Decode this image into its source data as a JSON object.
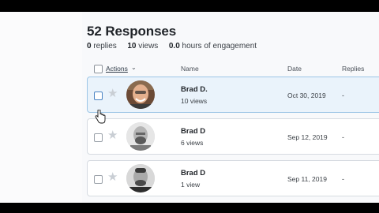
{
  "header": {
    "title": "52 Responses",
    "stats": [
      {
        "value": "0",
        "label": "replies"
      },
      {
        "value": "10",
        "label": "views"
      },
      {
        "value": "0.0",
        "label": "hours of engagement"
      }
    ]
  },
  "table": {
    "columns": {
      "actions": "Actions",
      "name": "Name",
      "date": "Date",
      "replies": "Replies"
    },
    "rows": [
      {
        "name": "Brad D.",
        "views": "10 views",
        "date": "Oct 30, 2019",
        "replies": "-",
        "selected": true
      },
      {
        "name": "Brad D",
        "views": "6 views",
        "date": "Sep 12, 2019",
        "replies": "-",
        "selected": false
      },
      {
        "name": "Brad D",
        "views": "1 view",
        "date": "Sep 11, 2019",
        "replies": "-",
        "selected": false
      }
    ]
  },
  "icons": {
    "star": "star-icon",
    "caret": "chevron-down-icon",
    "cursor": "hand-pointer-icon"
  },
  "colors": {
    "selected_row_bg": "#eaf3fb",
    "selected_row_border": "#9dc6e6",
    "star": "#c9ced4"
  }
}
